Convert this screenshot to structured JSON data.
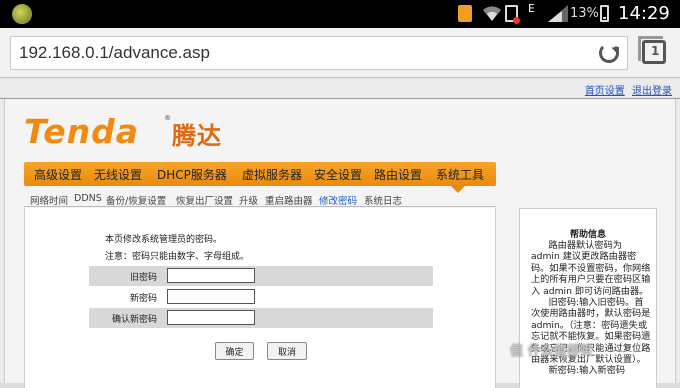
{
  "status_bar": {
    "network": "E",
    "battery": "13%",
    "time": "14:29"
  },
  "browser": {
    "url": "192.168.0.1/advance.asp",
    "tab_count": "1"
  },
  "top_links": {
    "home": "首页设置",
    "logout": "退出登录"
  },
  "brand": {
    "logo_text": "Tenda",
    "logo_cn": "腾达",
    "accent": "#f08a10"
  },
  "main_nav": [
    {
      "label": "高级设置"
    },
    {
      "label": "无线设置"
    },
    {
      "label": "DHCP服务器"
    },
    {
      "label": "虚拟服务器"
    },
    {
      "label": "安全设置"
    },
    {
      "label": "路由设置"
    },
    {
      "label": "系统工具"
    }
  ],
  "sub_nav": [
    {
      "label": "网络时间"
    },
    {
      "label": "DDNS"
    },
    {
      "label": "备份/恢复设置"
    },
    {
      "label": "恢复出厂设置"
    },
    {
      "label": "升级"
    },
    {
      "label": "重启路由器"
    },
    {
      "label": "修改密码"
    },
    {
      "label": "系统日志"
    }
  ],
  "form": {
    "description": "本页修改系统管理员的密码。",
    "note": "注意：密码只能由数字、字母组成。",
    "fields": [
      {
        "label": "旧密码",
        "value": ""
      },
      {
        "label": "新密码",
        "value": ""
      },
      {
        "label": "确认新密码",
        "value": ""
      }
    ],
    "ok_label": "确定",
    "cancel_label": "取消"
  },
  "help": {
    "title": "帮助信息",
    "paragraph1": "路由器默认密码为 admin 建议更改路由器密码。如果不设置密码，你网络上的所有用户只要在密码区输入 admin 即可访问路由器。",
    "paragraph2": "旧密码:输入旧密码。首次使用路由器时，默认密码是 admin。（注意：密码遗失或忘记就不能恢复。如果密码遗失或忘记，你只能通过复位路由器来恢复出厂默认设置）。",
    "paragraph3": "新密码:输入新密码"
  },
  "watermark": "值 什么值得买"
}
